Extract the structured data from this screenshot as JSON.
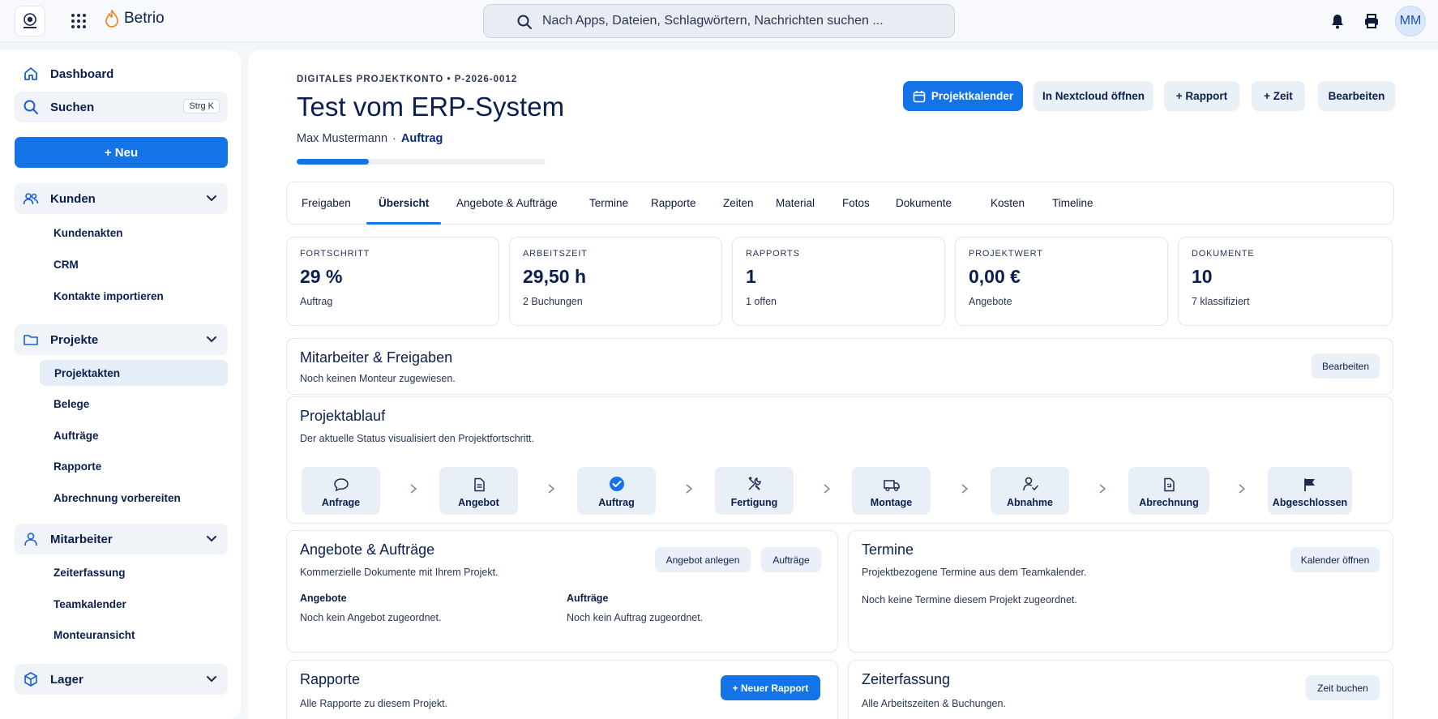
{
  "topbar": {
    "brand_name": "Betrio",
    "search_placeholder": "Nach Apps, Dateien, Schlagwörtern, Nachrichten suchen ...",
    "avatar_initials": "MM"
  },
  "sidebar": {
    "dashboard": "Dashboard",
    "search": "Suchen",
    "search_shortcut": "Strg  K",
    "new_button": "+ Neu",
    "groups": {
      "kunden": {
        "label": "Kunden",
        "items": [
          "Kundenakten",
          "CRM",
          "Kontakte importieren"
        ]
      },
      "projekte": {
        "label": "Projekte",
        "items": [
          "Projektakten",
          "Belege",
          "Aufträge",
          "Rapporte",
          "Abrechnung vorbereiten"
        ]
      },
      "mitarbeiter": {
        "label": "Mitarbeiter",
        "items": [
          "Zeiterfassung",
          "Teamkalender",
          "Monteuransicht"
        ]
      },
      "lager": {
        "label": "Lager"
      }
    }
  },
  "header": {
    "kicker": "DIGITALES PROJEKTKONTO • P-2026-0012",
    "title": "Test vom ERP-System",
    "owner": "Max Mustermann",
    "separator": "·",
    "status": "Auftrag",
    "progress_fraction": 0.29,
    "buttons": {
      "calendar": "Projektkalender",
      "nextcloud": "In Nextcloud öffnen",
      "rapport": "+ Rapport",
      "zeit": "+ Zeit",
      "edit": "Bearbeiten"
    }
  },
  "tabs": [
    "Freigaben",
    "Übersicht",
    "Angebote & Aufträge",
    "Termine",
    "Rapporte",
    "Zeiten",
    "Material",
    "Fotos",
    "Dokumente",
    "Kosten",
    "Timeline"
  ],
  "active_tab": "Übersicht",
  "stats": [
    {
      "label": "FORTSCHRITT",
      "value": "29 %",
      "sub": "Auftrag"
    },
    {
      "label": "ARBEITSZEIT",
      "value": "29,50 h",
      "sub": "2 Buchungen"
    },
    {
      "label": "RAPPORTS",
      "value": "1",
      "sub": "1 offen"
    },
    {
      "label": "PROJEKTWERT",
      "value": "0,00 €",
      "sub": "Angebote"
    },
    {
      "label": "DOKUMENTE",
      "value": "10",
      "sub": "7 klassifiziert"
    }
  ],
  "team": {
    "title": "Mitarbeiter & Freigaben",
    "desc": "Noch keinen Monteur zugewiesen.",
    "edit": "Bearbeiten"
  },
  "workflow": {
    "title": "Projektablauf",
    "desc": "Der aktuelle Status visualisiert den Projektfortschritt.",
    "steps": [
      "Anfrage",
      "Angebot",
      "Auftrag",
      "Fertigung",
      "Montage",
      "Abnahme",
      "Abrechnung",
      "Abgeschlossen"
    ]
  },
  "offers": {
    "title": "Angebote & Aufträge",
    "desc": "Kommerzielle Dokumente mit Ihrem Projekt.",
    "btn_create": "Angebot anlegen",
    "btn_orders": "Aufträge",
    "col1_head": "Angebote",
    "col1_text": "Noch kein Angebot zugeordnet.",
    "col2_head": "Aufträge",
    "col2_text": "Noch kein Auftrag zugeordnet."
  },
  "appointments": {
    "title": "Termine",
    "desc": "Projektbezogene Termine aus dem Teamkalender.",
    "btn": "Kalender öffnen",
    "empty": "Noch keine Termine diesem Projekt zugeordnet."
  },
  "reports": {
    "title": "Rapporte",
    "desc": "Alle Rapporte zu diesem Projekt.",
    "btn": "+ Neuer Rapport"
  },
  "timetracking": {
    "title": "Zeiterfassung",
    "desc": "Alle Arbeitszeiten & Buchungen.",
    "btn": "Zeit buchen"
  },
  "colors": {
    "accent": "#1473e6",
    "navy": "#0b1f4f",
    "orange": "#f08a24"
  }
}
